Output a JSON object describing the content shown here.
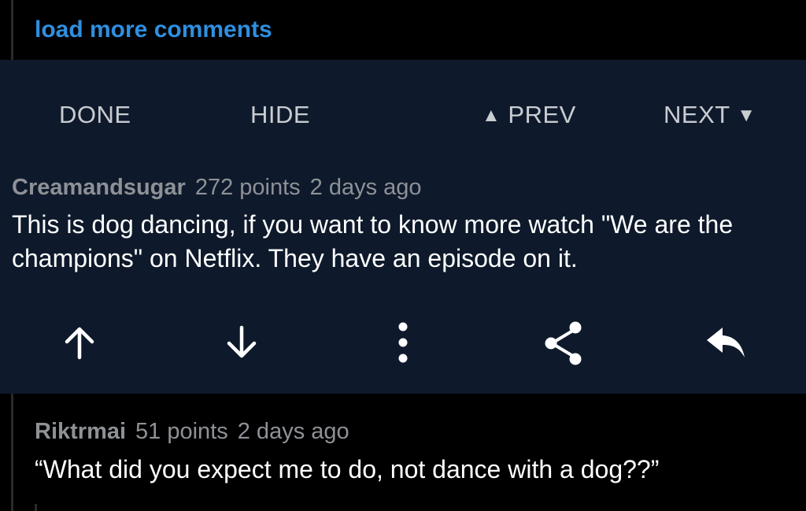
{
  "load_more": {
    "label": "load more comments",
    "color": "#2f8fe0"
  },
  "nav": {
    "done": "DONE",
    "hide": "HIDE",
    "prev_arrow": "▲",
    "prev": "PREV",
    "next": "NEXT",
    "next_arrow": "▼"
  },
  "selected_comment": {
    "author": "Creamandsugar",
    "points": "272 points",
    "age": "2 days ago",
    "body": "This is dog dancing, if you want to know more watch \"We are the champions\" on Netflix. They have an episode on it."
  },
  "actions": {
    "icons": [
      "arrow-up-icon",
      "arrow-down-icon",
      "more-vertical-icon",
      "share-icon",
      "reply-icon"
    ]
  },
  "reply_comment": {
    "author": "Riktrmai",
    "points": "51 points",
    "age": "2 days ago",
    "body": "“What did you expect me to do, not dance with a dog??”"
  },
  "colors": {
    "panel_bg": "#0e1a2b",
    "page_bg": "#000000",
    "text": "#ffffff",
    "meta": "#8e9196",
    "nav": "#c9ccd1"
  }
}
